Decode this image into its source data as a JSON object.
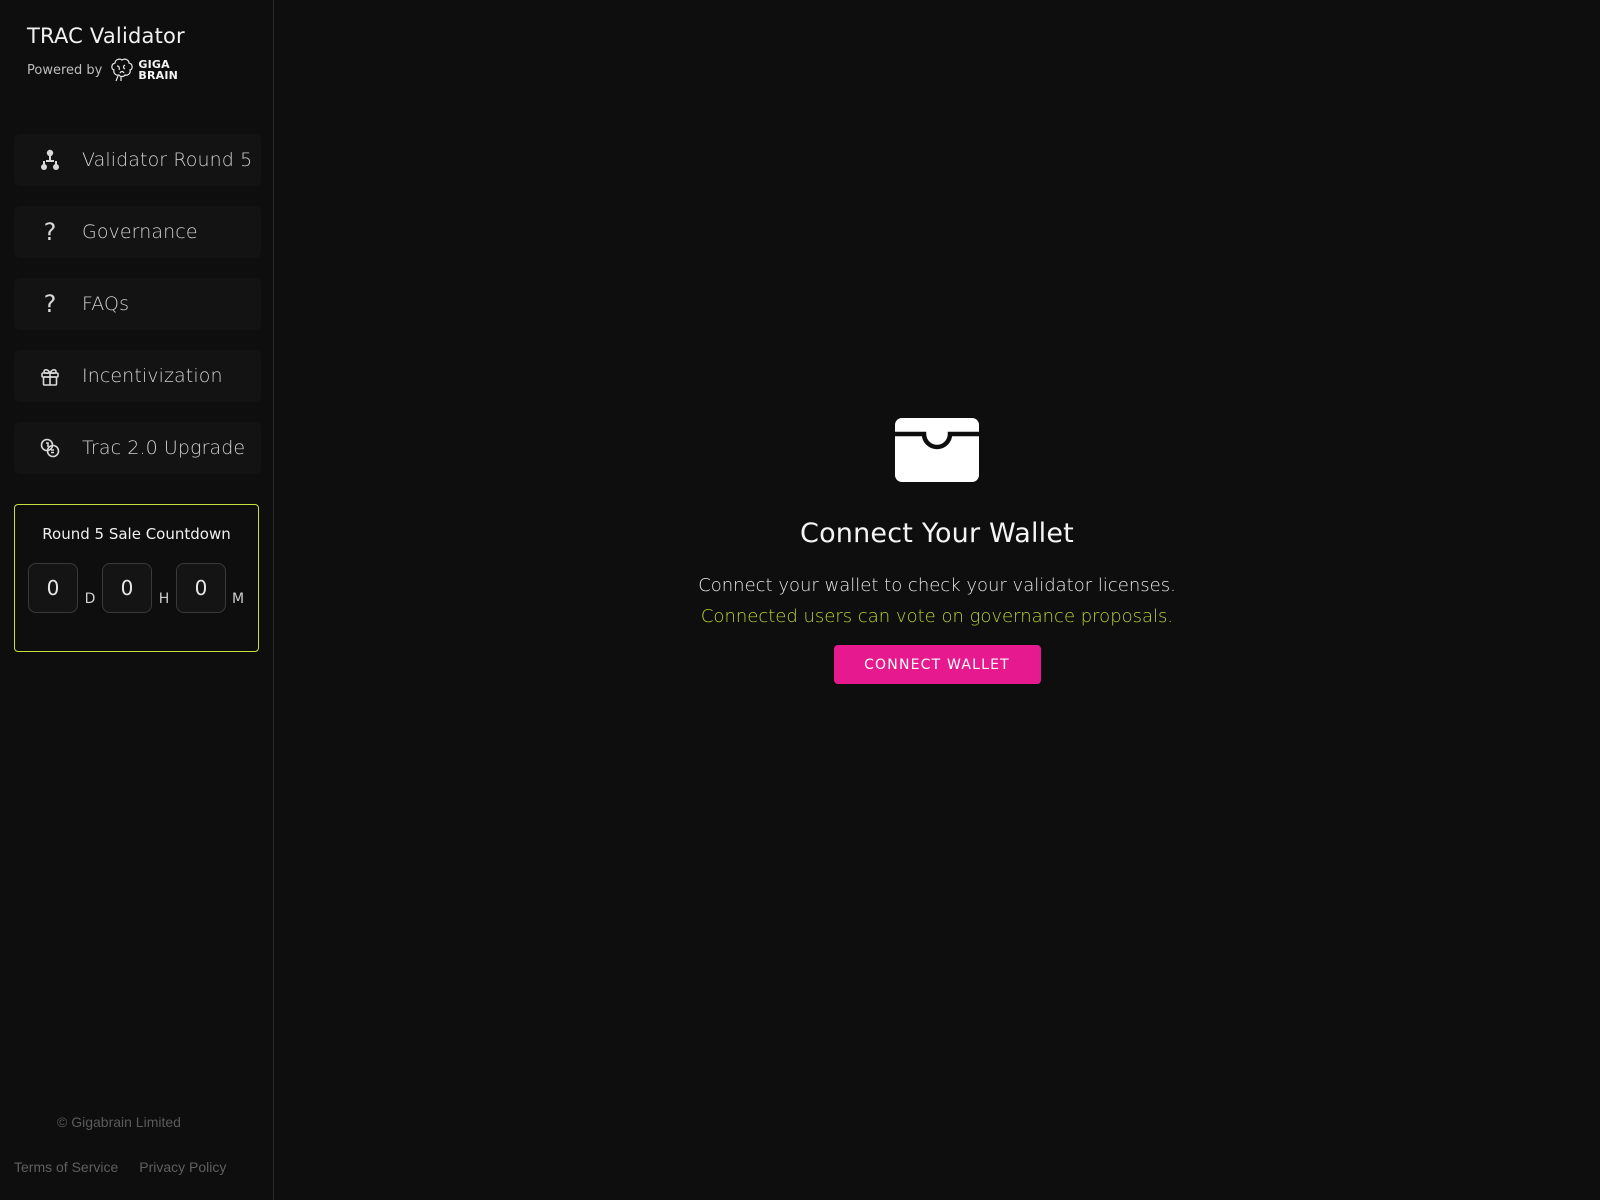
{
  "brand": {
    "title": "TRAC Validator",
    "powered_by": "Powered by",
    "logo_line1": "GIGA",
    "logo_line2": "BRAIN"
  },
  "sidebar": {
    "items": [
      {
        "label": "Validator Round 5",
        "icon": "network-icon"
      },
      {
        "label": "Governance",
        "icon": "question-icon"
      },
      {
        "label": "FAQs",
        "icon": "question-icon"
      },
      {
        "label": "Incentivization",
        "icon": "gift-icon"
      },
      {
        "label": "Trac 2.0 Upgrade",
        "icon": "coins-icon"
      }
    ]
  },
  "countdown": {
    "title": "Round 5 Sale Countdown",
    "days": "0",
    "days_unit": "D",
    "hours": "0",
    "hours_unit": "H",
    "minutes": "0",
    "minutes_unit": "M",
    "accent_color": "#c6e23a"
  },
  "footer": {
    "copyright": "© Gigabrain Limited",
    "terms": "Terms of Service",
    "privacy": "Privacy Policy"
  },
  "main": {
    "icon": "wallet-icon",
    "title": "Connect Your Wallet",
    "description": "Connect your wallet to check your validator licenses.",
    "accent_text": "Connected users can vote on governance proposals.",
    "button_label": "CONNECT WALLET",
    "button_color": "#e6198f",
    "accent_color": "#b6d234"
  }
}
